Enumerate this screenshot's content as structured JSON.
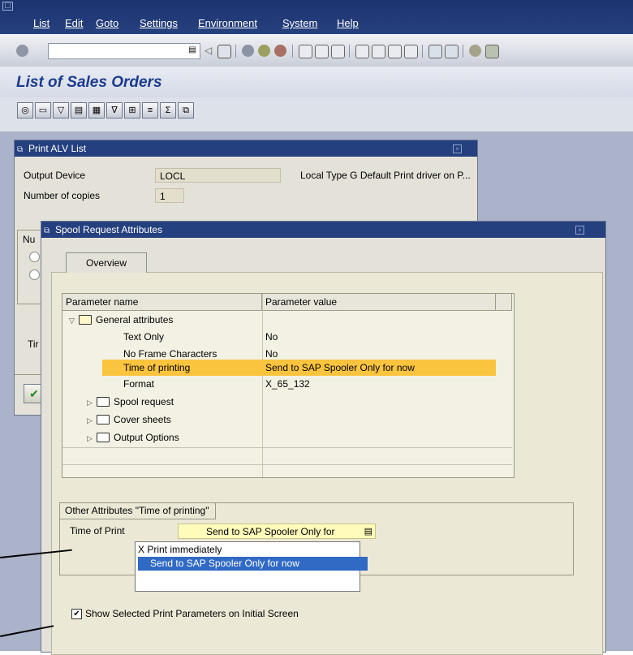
{
  "menubar": {
    "items": [
      "List",
      "Edit",
      "Goto",
      "Settings",
      "Environment",
      "System",
      "Help"
    ]
  },
  "toolbar": {
    "command_value": ""
  },
  "page": {
    "title": "List of Sales Orders"
  },
  "print_dialog": {
    "title": "Print ALV List",
    "output_device_label": "Output Device",
    "output_device_value": "LOCL",
    "output_device_desc": "Local Type G Default Print driver on P...",
    "copies_label": "Number of copies",
    "copies_value": "1",
    "partial_number_label": "Nu",
    "partial_time_label": "Tir"
  },
  "spool_dialog": {
    "title": "Spool Request Attributes",
    "tab_overview": "Overview",
    "table": {
      "col_name": "Parameter name",
      "col_value": "Parameter value",
      "general_attributes": "General attributes",
      "rows": [
        {
          "name": "Text Only",
          "value": "No"
        },
        {
          "name": "No Frame Characters",
          "value": "No"
        },
        {
          "name": "Time of printing",
          "value": "Send to SAP Spooler Only for now"
        },
        {
          "name": "Format",
          "value": "X_65_132"
        }
      ],
      "folders": [
        "Spool request",
        "Cover sheets",
        "Output Options"
      ]
    },
    "other_attributes": {
      "legend": "Other Attributes \"Time of printing\"",
      "time_of_print_label": "Time of Print",
      "time_of_print_value": "Send to SAP Spooler Only for"
    },
    "dropdown": {
      "options": [
        "X Print immediately",
        "Send to SAP Spooler Only for now"
      ]
    },
    "show_params_label": "Show Selected Print Parameters on Initial Screen"
  },
  "colors": {
    "titlebar_blue": "#25407e",
    "highlight_row": "#fbc43f",
    "dropdown_selected": "#316ac5",
    "title_text": "#1b3c8e"
  }
}
